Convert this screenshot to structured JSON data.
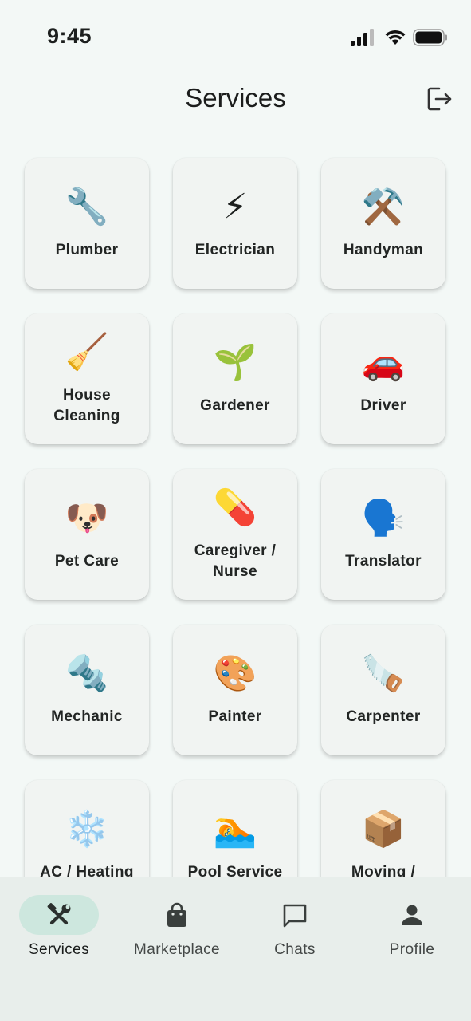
{
  "status_bar": {
    "time": "9:45"
  },
  "header": {
    "title": "Services",
    "logout_icon": "logout-icon"
  },
  "services": [
    {
      "name": "plumber",
      "label": "Plumber",
      "emoji": "🔧",
      "icon": "wrench-icon"
    },
    {
      "name": "electrician",
      "label": "Electrician",
      "emoji": "⚡",
      "icon": "lightning-icon"
    },
    {
      "name": "handyman",
      "label": "Handyman",
      "emoji": "⚒️",
      "icon": "hammer-wrench-icon"
    },
    {
      "name": "house-cleaning",
      "label": "House\nCleaning",
      "emoji": "🧹",
      "icon": "broom-icon"
    },
    {
      "name": "gardener",
      "label": "Gardener",
      "emoji": "🌱",
      "icon": "seedling-icon"
    },
    {
      "name": "driver",
      "label": "Driver",
      "emoji": "🚗",
      "icon": "car-icon"
    },
    {
      "name": "pet-care",
      "label": "Pet Care",
      "emoji": "🐶",
      "icon": "dog-icon"
    },
    {
      "name": "caregiver-nurse",
      "label": "Caregiver /\nNurse",
      "emoji": "💊",
      "icon": "pill-icon"
    },
    {
      "name": "translator",
      "label": "Translator",
      "emoji": "🗣️",
      "icon": "speaking-head-icon"
    },
    {
      "name": "mechanic",
      "label": "Mechanic",
      "emoji": "🔩",
      "icon": "nut-bolt-icon"
    },
    {
      "name": "painter",
      "label": "Painter",
      "emoji": "🎨",
      "icon": "palette-icon"
    },
    {
      "name": "carpenter",
      "label": "Carpenter",
      "emoji": "🪚",
      "icon": "saw-icon"
    },
    {
      "name": "ac-heating",
      "label": "AC / Heating",
      "emoji": "❄️",
      "icon": "snowflake-icon"
    },
    {
      "name": "pool-service",
      "label": "Pool Service",
      "emoji": "🏊",
      "icon": "swimmer-icon"
    },
    {
      "name": "moving",
      "label": "Moving /",
      "emoji": "📦",
      "icon": "package-icon"
    }
  ],
  "bottom_nav": {
    "items": [
      {
        "label": "Services",
        "icon": "tools-icon",
        "active": true
      },
      {
        "label": "Marketplace",
        "icon": "shopping-bag-icon",
        "active": false
      },
      {
        "label": "Chats",
        "icon": "chat-bubble-icon",
        "active": false
      },
      {
        "label": "Profile",
        "icon": "person-icon",
        "active": false
      }
    ]
  }
}
